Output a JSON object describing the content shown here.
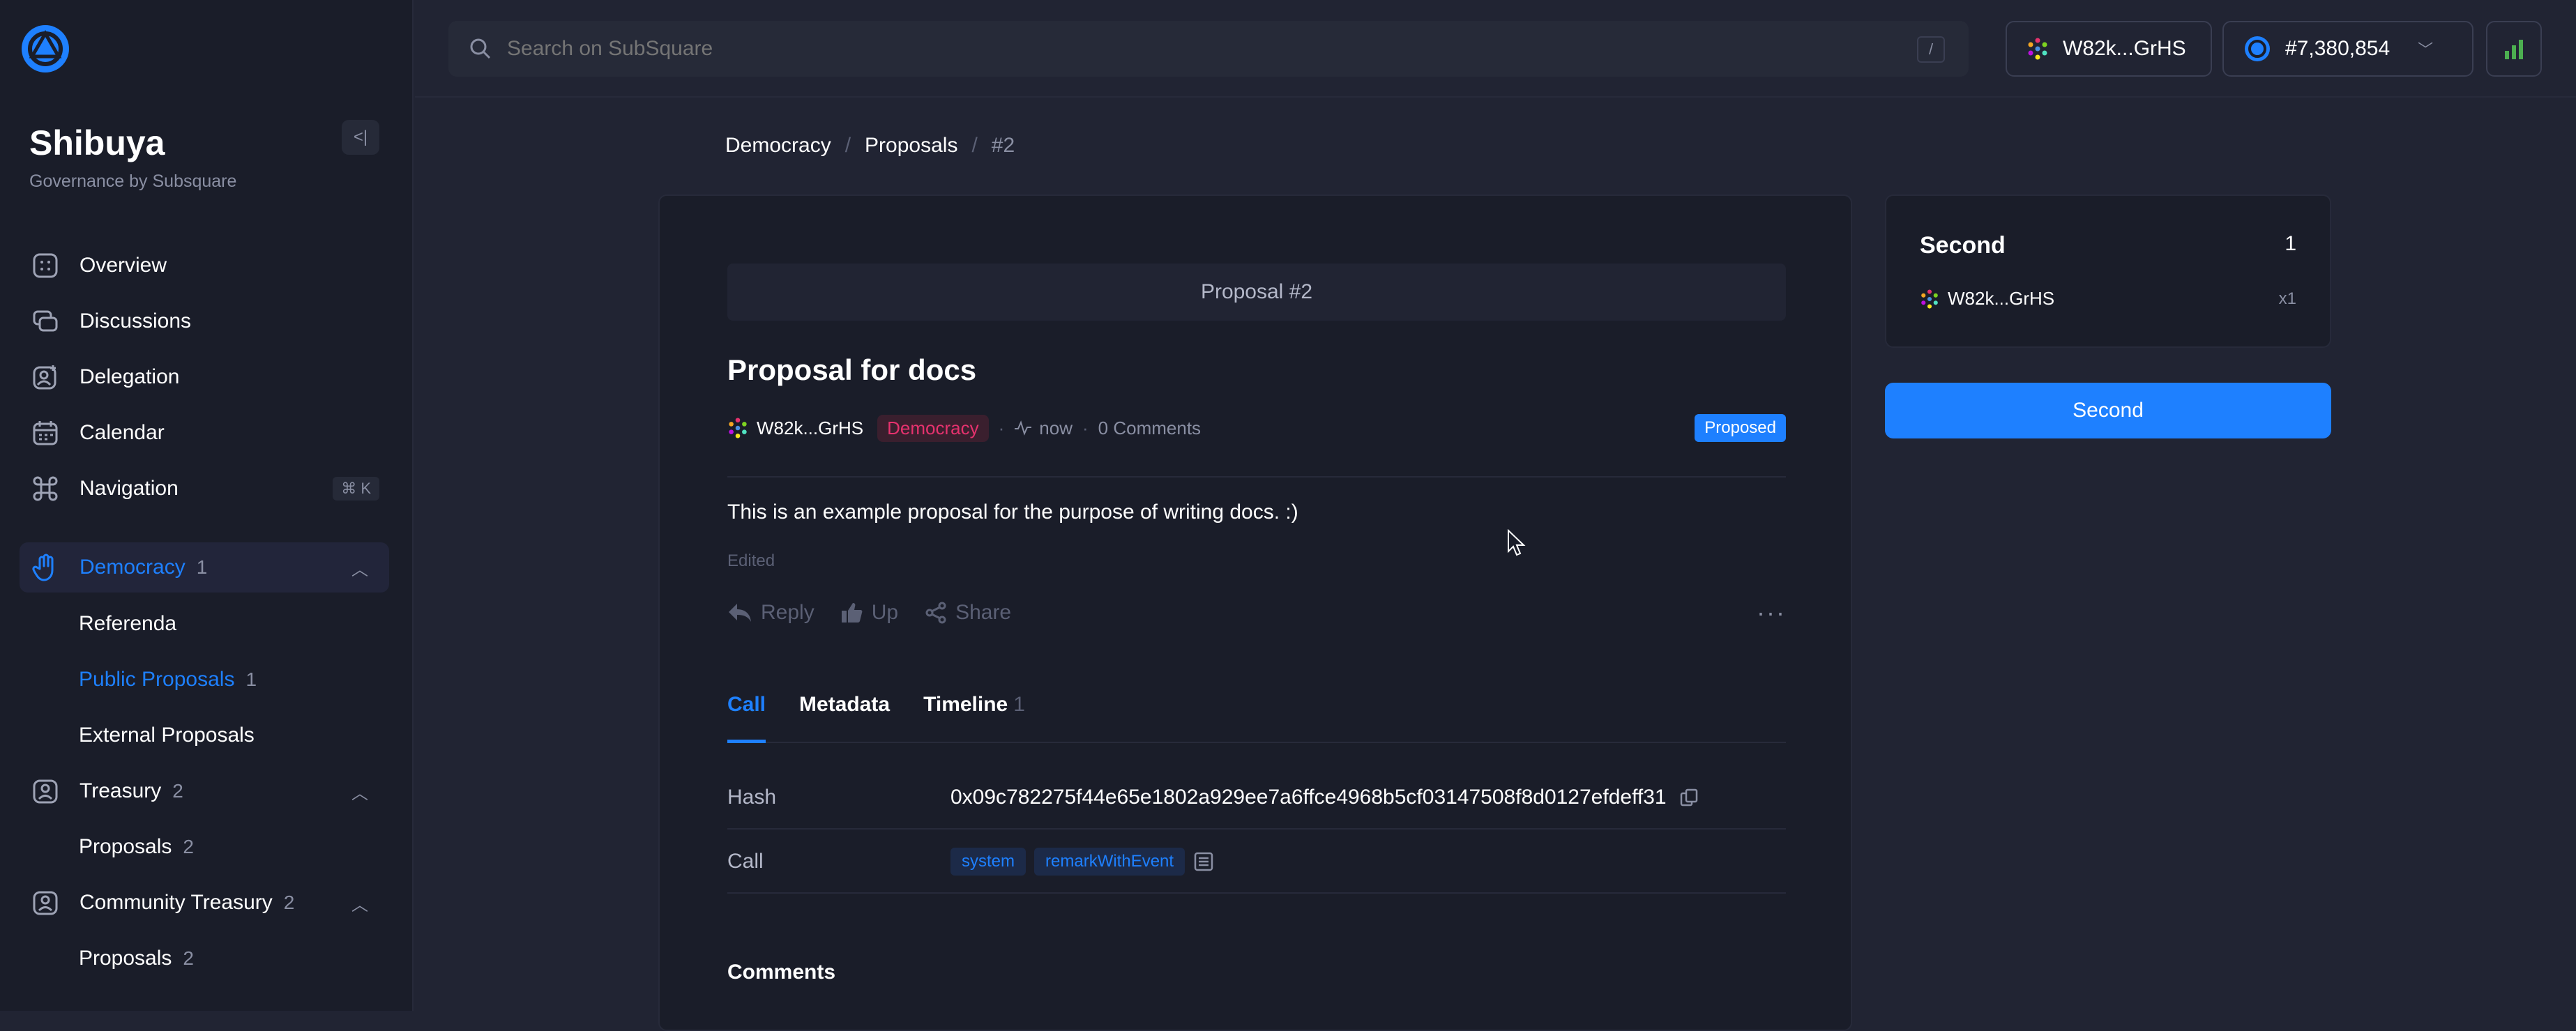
{
  "sidebar": {
    "brand_title": "Shibuya",
    "brand_subtitle": "Governance by Subsquare",
    "collapse_label": "<|",
    "items": [
      {
        "label": "Overview",
        "icon": "overview-icon"
      },
      {
        "label": "Discussions",
        "icon": "discussions-icon"
      },
      {
        "label": "Delegation",
        "icon": "delegation-icon"
      },
      {
        "label": "Calendar",
        "icon": "calendar-icon"
      },
      {
        "label": "Navigation",
        "icon": "command-icon",
        "shortcut": "⌘ K"
      },
      {
        "label": "Democracy",
        "count": "1",
        "icon": "hand-icon",
        "active": true
      },
      {
        "label": "Treasury",
        "count": "2",
        "icon": "treasury-icon"
      },
      {
        "label": "Community Treasury",
        "count": "2",
        "icon": "community-treasury-icon"
      }
    ],
    "democracy_sub": [
      {
        "label": "Referenda",
        "count": ""
      },
      {
        "label": "Public Proposals",
        "count": "1",
        "active": true
      },
      {
        "label": "External Proposals",
        "count": ""
      }
    ],
    "treasury_sub": [
      {
        "label": "Proposals",
        "count": "2"
      }
    ],
    "community_sub": [
      {
        "label": "Proposals",
        "count": "2"
      }
    ]
  },
  "topbar": {
    "search_placeholder": "Search on SubSquare",
    "search_shortcut": "/",
    "account": "W82k...GrHS",
    "block": "#7,380,854"
  },
  "breadcrumb": {
    "level1": "Democracy",
    "level2": "Proposals",
    "current": "#2"
  },
  "proposal": {
    "header": "Proposal #2",
    "title": "Proposal for docs",
    "author": "W82k...GrHS",
    "category": "Democracy",
    "time": "now",
    "comments_count": "0 Comments",
    "status": "Proposed",
    "body": "This is an example proposal for the purpose of writing docs. :)",
    "edited": "Edited",
    "actions": {
      "reply": "Reply",
      "up": "Up",
      "share": "Share",
      "more": "···"
    }
  },
  "tabs": [
    {
      "label": "Call",
      "active": true
    },
    {
      "label": "Metadata"
    },
    {
      "label": "Timeline",
      "count": "1"
    }
  ],
  "call": {
    "hash_label": "Hash",
    "hash_value": "0x09c782275f44e65e1802a929ee7a6ffce4968b5cf03147508f8d0127efdeff31",
    "call_label": "Call",
    "call_section": "system",
    "call_method": "remarkWithEvent"
  },
  "comments_title": "Comments",
  "second_panel": {
    "title": "Second",
    "count": "1",
    "seconder": "W82k...GrHS",
    "multiplier": "x1",
    "button_label": "Second"
  },
  "colors": {
    "accent": "#1e80ff",
    "democracy": "#e6326e",
    "background": "#212433"
  }
}
